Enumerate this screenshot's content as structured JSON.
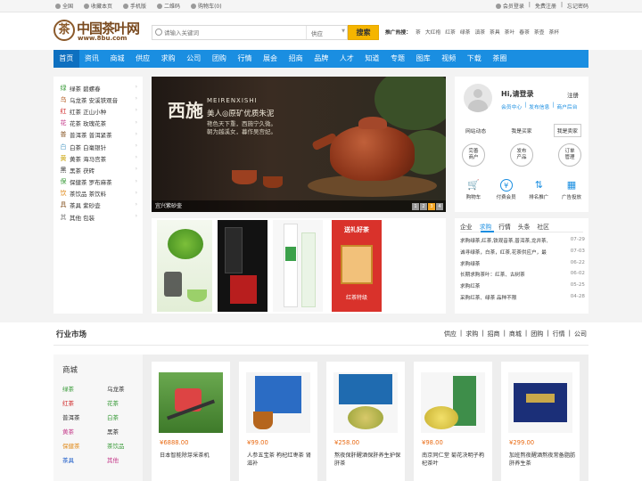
{
  "topbar": {
    "left": [
      "全国",
      "收藏本页",
      "手机版",
      "二维码",
      "购物车(0)"
    ],
    "right": [
      "会员登录",
      "|",
      "免费注册",
      "|",
      "忘记密码"
    ]
  },
  "logo": {
    "name": "中国茶叶网",
    "url": "www.8bu.com",
    "seal": "茶"
  },
  "search": {
    "placeholder": "请输入关键词",
    "scope": "供应",
    "button": "搜索"
  },
  "hot": {
    "label": "推广热搜：",
    "items": [
      "茶",
      "大红袍",
      "红茶",
      "绿茶",
      "滇茶",
      "茶具",
      "茶叶",
      "春茶",
      "茶壶",
      "茶杯"
    ]
  },
  "nav": [
    "首页",
    "资讯",
    "商城",
    "供应",
    "求购",
    "公司",
    "团购",
    "行情",
    "展会",
    "招商",
    "品牌",
    "人才",
    "知道",
    "专题",
    "图库",
    "视频",
    "下载",
    "茶圈"
  ],
  "categories": [
    {
      "icon": "绿",
      "label": "绿茶  碧螺春",
      "color": "#3a9b3a"
    },
    {
      "icon": "乌",
      "label": "乌龙茶  安溪铁观音",
      "color": "#b35a1f"
    },
    {
      "icon": "红",
      "label": "红茶  正山小种",
      "color": "#d02a2a"
    },
    {
      "icon": "花",
      "label": "花茶  玫瑰花茶",
      "color": "#c43a8a"
    },
    {
      "icon": "普",
      "label": "普洱茶  普洱紧茶",
      "color": "#8a5a2a"
    },
    {
      "icon": "白",
      "label": "白茶  白毫银针",
      "color": "#5aa0c8"
    },
    {
      "icon": "黄",
      "label": "黄茶  海马宫茶",
      "color": "#c8a000"
    },
    {
      "icon": "黑",
      "label": "黑茶  茯砖",
      "color": "#333333"
    },
    {
      "icon": "保",
      "label": "保健茶  罗布麻茶",
      "color": "#3a9b3a"
    },
    {
      "icon": "饮",
      "label": "茶饮品  茶饮料",
      "color": "#e08a1a"
    },
    {
      "icon": "具",
      "label": "茶具  紫砂壶",
      "color": "#8a5a2a"
    },
    {
      "icon": "其",
      "label": "其他  包装",
      "color": "#888888"
    }
  ],
  "hero": {
    "title": "西施",
    "brand": "MEIRENXISHI",
    "line1": "美人◎原矿优质朱泥",
    "line2a": "艳色天下重，西施宁久微。",
    "line2b": "朝为越溪女，暮作吴宫妃。",
    "caption": "宜兴紫砂壶",
    "pages": [
      "1",
      "2",
      "3",
      "4"
    ]
  },
  "promo_box": {
    "line1": "送礼好茶",
    "line2": "红茶特级"
  },
  "login": {
    "greeting": "Hi,请登录",
    "register": "注册",
    "links": [
      "会员中心",
      "|",
      "发布信息",
      "|",
      "商户后台"
    ],
    "tabs": [
      "网站动态",
      "我是买家",
      "我是卖家"
    ],
    "actions": [
      "完善\n商户",
      "发布\n产品",
      "订单\n管理"
    ],
    "icons": [
      {
        "glyph": "🛒",
        "label": "购物车",
        "name": "cart-icon"
      },
      {
        "glyph": "¥",
        "label": "付费会员",
        "name": "yuan-icon"
      },
      {
        "glyph": "⇅",
        "label": "排名推广",
        "name": "rank-icon"
      },
      {
        "glyph": "▦",
        "label": "广告投放",
        "name": "ad-icon"
      }
    ]
  },
  "news": {
    "tabs": [
      "企业",
      "求购",
      "行情",
      "头条",
      "社区"
    ],
    "active_tab": 1,
    "items": [
      {
        "title": "求购绿茶,红茶,铁观音茶,普洱茶,龙井茶,",
        "date": "07-29"
      },
      {
        "title": "诚寻绿茶，白茶，红茶,花茶供应户，最",
        "date": "07-03"
      },
      {
        "title": "求购绿茶",
        "date": "06-22"
      },
      {
        "title": "长期求购茶叶：红茶、古树茶",
        "date": "06-02"
      },
      {
        "title": "求购红茶",
        "date": "05-25"
      },
      {
        "title": "采购红茶、绿茶 品种不限",
        "date": "04-28"
      }
    ]
  },
  "market": {
    "title": "行业市场",
    "links": [
      "供应",
      "|",
      "求购",
      "|",
      "招商",
      "|",
      "商城",
      "|",
      "团购",
      "|",
      "行情",
      "|",
      "公司"
    ],
    "sidebar_title": "商城",
    "cats": [
      {
        "label": "绿茶",
        "color": "#3a9b3a"
      },
      {
        "label": "乌龙茶",
        "color": "#333333"
      },
      {
        "label": "红茶",
        "color": "#d02a2a"
      },
      {
        "label": "花茶",
        "color": "#3a9b3a"
      },
      {
        "label": "普洱茶",
        "color": "#333333"
      },
      {
        "label": "白茶",
        "color": "#3a9b3a"
      },
      {
        "label": "黄茶",
        "color": "#c43a8a"
      },
      {
        "label": "黑茶",
        "color": "#333333"
      },
      {
        "label": "保健茶",
        "color": "#e08a1a"
      },
      {
        "label": "茶饮品",
        "color": "#3a9b3a"
      },
      {
        "label": "茶具",
        "color": "#1a5ac8"
      },
      {
        "label": "其他",
        "color": "#c43a8a"
      }
    ],
    "products": [
      {
        "price": "¥6888.00",
        "name": "日本智能除芽采茶机"
      },
      {
        "price": "¥99.00",
        "name": "人参五宝茶 枸杞红枣茶 肾滋补"
      },
      {
        "price": "¥258.00",
        "name": "熬夜保肝醒酒保肝养生护保肝茶"
      },
      {
        "price": "¥98.00",
        "name": "南京同仁堂 菊花决明子枸杞茶叶"
      },
      {
        "price": "¥299.00",
        "name": "加班熬夜醒酒熬夜常备脂肪肝养生茶"
      }
    ]
  },
  "colors": {
    "accent": "#1a8ee1",
    "price": "#e96b14",
    "search_button": "#f5b500"
  }
}
